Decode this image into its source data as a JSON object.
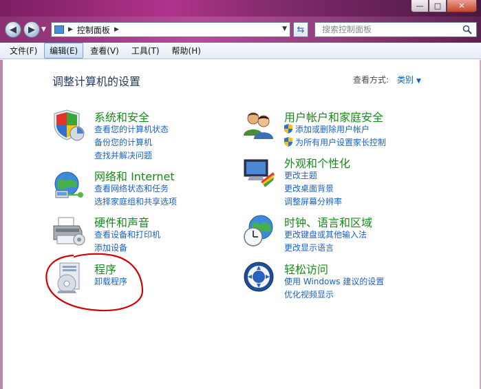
{
  "window": {
    "minimize": "—",
    "maximize": "□",
    "close": "✕"
  },
  "address_bar": {
    "breadcrumb": "控制面板",
    "separator": "▶",
    "search_placeholder": "搜索控制面板"
  },
  "menu": [
    {
      "label": "文件(F)"
    },
    {
      "label": "编辑(E)"
    },
    {
      "label": "查看(V)"
    },
    {
      "label": "工具(T)"
    },
    {
      "label": "帮助(H)"
    }
  ],
  "page": {
    "title": "调整计算机的设置",
    "view_by_label": "查看方式:",
    "view_by_value": "类别"
  },
  "categories": {
    "system": {
      "title": "系统和安全",
      "icon": "shield-icon",
      "links": [
        "查看您的计算机状态",
        "备份您的计算机",
        "查找并解决问题"
      ]
    },
    "network": {
      "title": "网络和 Internet",
      "icon": "network-globe-icon",
      "links": [
        "查看网络状态和任务",
        "选择家庭组和共享选项"
      ]
    },
    "hardware": {
      "title": "硬件和声音",
      "icon": "printer-icon",
      "links": [
        "查看设备和打印机",
        "添加设备"
      ]
    },
    "programs": {
      "title": "程序",
      "icon": "programs-disc-icon",
      "links": [
        "卸载程序"
      ]
    },
    "users": {
      "title": "用户帐户和家庭安全",
      "icon": "users-icon",
      "links": [
        "添加或删除用户帐户",
        "为所有用户设置家长控制"
      ]
    },
    "appearance": {
      "title": "外观和个性化",
      "icon": "monitor-palette-icon",
      "links": [
        "更改主题",
        "更改桌面背景",
        "调整屏幕分辨率"
      ]
    },
    "clock": {
      "title": "时钟、语言和区域",
      "icon": "globe-clock-icon",
      "links": [
        "更改键盘或其他输入法",
        "更改显示语言"
      ]
    },
    "ease": {
      "title": "轻松访问",
      "icon": "ease-of-access-icon",
      "links": [
        "使用 Windows 建议的设置",
        "优化视频显示"
      ]
    }
  },
  "colors": {
    "category_title": "#168a17",
    "link": "#1a61c5",
    "annotation": "#d40000"
  }
}
